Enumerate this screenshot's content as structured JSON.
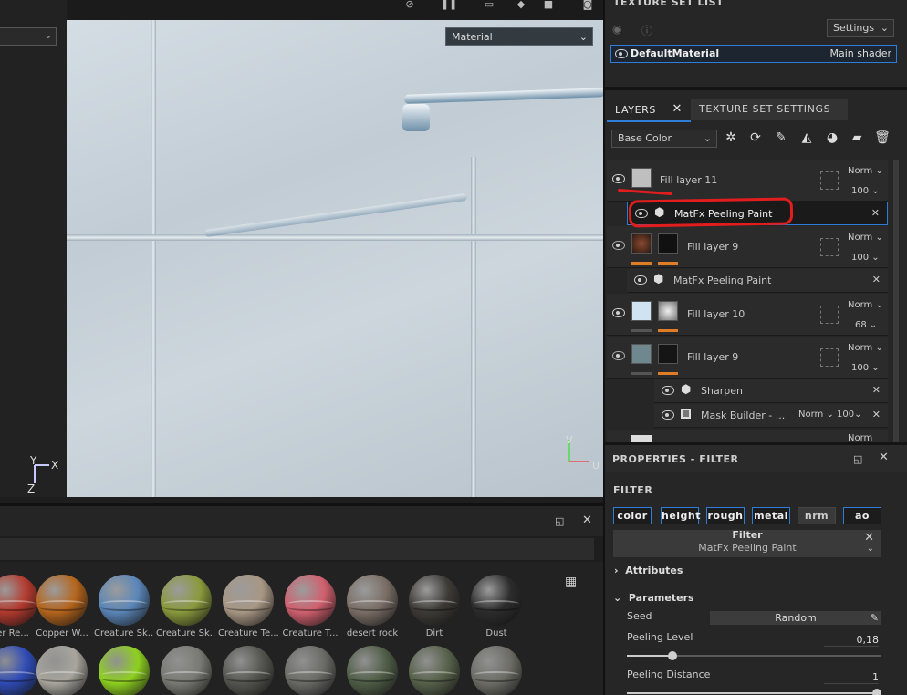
{
  "viewport": {
    "material_dropdown": "Material"
  },
  "axis_left": {
    "y": "Y",
    "x": "X",
    "z": "Z"
  },
  "axis_right": {
    "v": "V",
    "u": "U"
  },
  "shelf": {
    "row1": [
      {
        "label": "er Re...",
        "color": "#b33a2e"
      },
      {
        "label": "Copper W...",
        "color": "#b5651d"
      },
      {
        "label": "Creature Sk...",
        "color": "#5b86b8"
      },
      {
        "label": "Creature Sk...",
        "color": "#8a9a3c"
      },
      {
        "label": "Creature Te...",
        "color": "#a89784"
      },
      {
        "label": "Creature T...",
        "color": "#d0606e"
      },
      {
        "label": "desert rock",
        "color": "#7a6e66"
      },
      {
        "label": "Dirt",
        "color": "#3d3a36"
      },
      {
        "label": "Dust",
        "color": "#2c2c2c"
      }
    ],
    "row2_colors": [
      "#2f4bb5",
      "#a8a59d",
      "#8ed020",
      "#7a7a74",
      "#555550",
      "#6a6a66",
      "#4f5d46",
      "#56614a",
      "#6d6d66"
    ]
  },
  "texture_set_list": {
    "title": "TEXTURE SET LIST",
    "settings_label": "Settings",
    "material": {
      "name": "DefaultMaterial",
      "shader": "Main shader"
    }
  },
  "layers_panel": {
    "tab_layers": "LAYERS",
    "tab_texture_set_settings": "TEXTURE SET SETTINGS",
    "channel": "Base Color",
    "rows": [
      {
        "name": "Fill layer 11",
        "blend": "Norm",
        "opacity": "100"
      },
      {
        "name": "MatFx Peeling Paint"
      },
      {
        "name": "Fill layer 9",
        "blend": "Norm",
        "opacity": "100"
      },
      {
        "name": "MatFx Peeling Paint"
      },
      {
        "name": "Fill layer 10",
        "blend": "Norm",
        "opacity": "68"
      },
      {
        "name": "Fill layer 9",
        "blend": "Norm",
        "opacity": "100"
      },
      {
        "name": "Sharpen"
      },
      {
        "name": "Mask Builder - ...",
        "blend": "Norm",
        "opacity": "100"
      }
    ],
    "partial_row_blend": "Norm"
  },
  "properties": {
    "title": "PROPERTIES - FILTER",
    "section": "FILTER",
    "chips": [
      "color",
      "height",
      "rough",
      "metal",
      "nrm",
      "ao"
    ],
    "filter_label": "Filter",
    "filter_name": "MatFx Peeling Paint",
    "attributes": "Attributes",
    "parameters": "Parameters",
    "seed_label": "Seed",
    "seed_value": "Random",
    "peeling_level_label": "Peeling Level",
    "peeling_level_value": "0,18",
    "peeling_level_fraction": 0.18,
    "peeling_distance_label": "Peeling Distance",
    "peeling_distance_value": "1",
    "peeling_distance_fraction": 1.0
  }
}
